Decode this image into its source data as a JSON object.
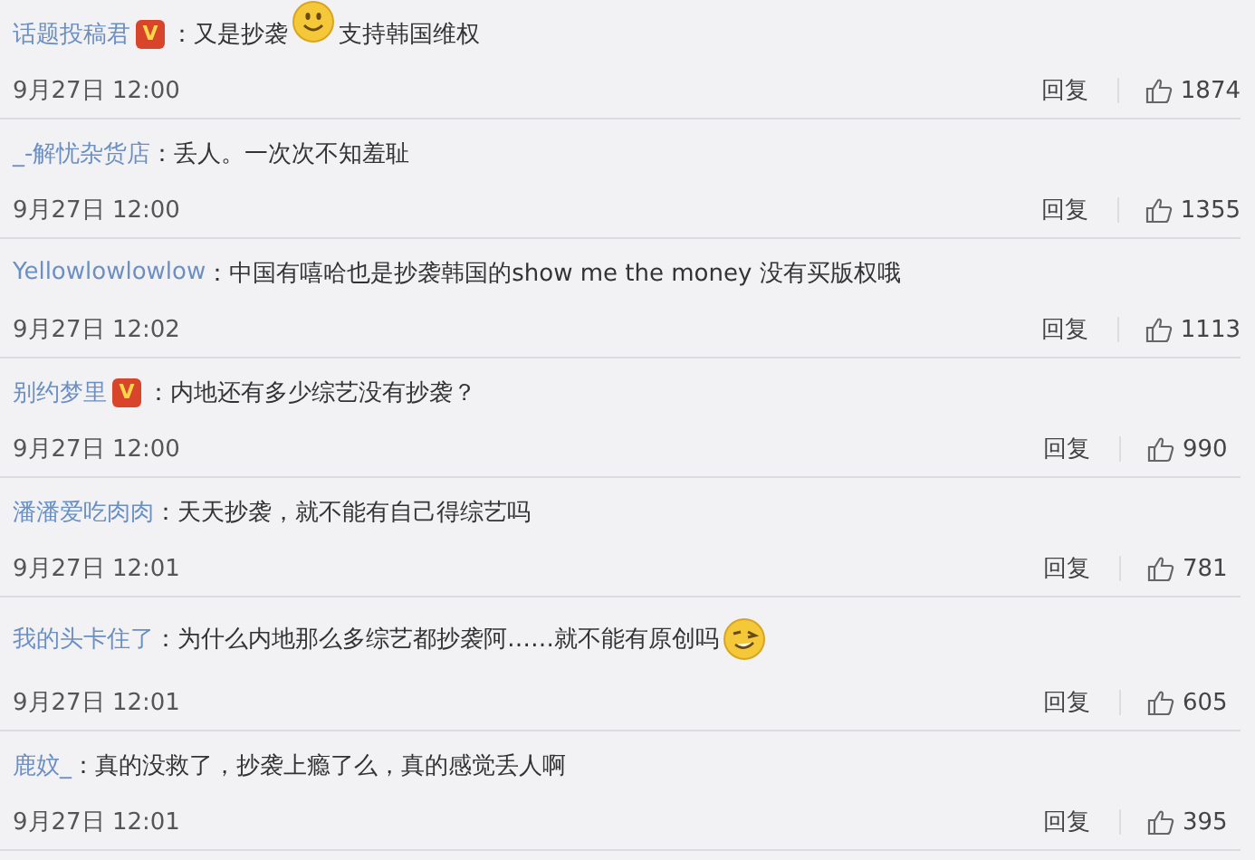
{
  "comments": [
    {
      "user": "话题投稿君",
      "badge": "V",
      "parts": [
        {
          "kind": "text",
          "text": "：又是抄袭"
        },
        {
          "kind": "smile"
        },
        {
          "kind": "text",
          "text": "支持韩国维权"
        }
      ],
      "time": "9月27日 12:00",
      "reply": "回复",
      "likes": "1874"
    },
    {
      "user": "_-解忧杂货店",
      "parts": [
        {
          "kind": "text",
          "text": "：丢人。一次次不知羞耻"
        }
      ],
      "time": "9月27日 12:00",
      "reply": "回复",
      "likes": "1355"
    },
    {
      "user": "Yellowlowlowlow",
      "parts": [
        {
          "kind": "text",
          "text": "：中国有嘻哈也是抄袭韩国的show me the money 没有买版权哦"
        }
      ],
      "time": "9月27日 12:02",
      "reply": "回复",
      "likes": "1113"
    },
    {
      "user": "别约梦里",
      "badge": "V",
      "parts": [
        {
          "kind": "text",
          "text": "：内地还有多少综艺没有抄袭？"
        }
      ],
      "time": "9月27日 12:00",
      "reply": "回复",
      "likes": "990"
    },
    {
      "user": "潘潘爱吃肉肉",
      "parts": [
        {
          "kind": "text",
          "text": "：天天抄袭，就不能有自己得综艺吗"
        }
      ],
      "time": "9月27日 12:01",
      "reply": "回复",
      "likes": "781"
    },
    {
      "user": "我的头卡住了",
      "parts": [
        {
          "kind": "text",
          "text": "：为什么内地那么多综艺都抄袭阿……就不能有原创吗"
        },
        {
          "kind": "wink"
        }
      ],
      "time": "9月27日 12:01",
      "reply": "回复",
      "likes": "605"
    },
    {
      "user": "鹿妏_",
      "parts": [
        {
          "kind": "text",
          "text": "：真的没救了，抄袭上瘾了么，真的感觉丢人啊"
        }
      ],
      "time": "9月27日 12:01",
      "reply": "回复",
      "likes": "395"
    }
  ]
}
